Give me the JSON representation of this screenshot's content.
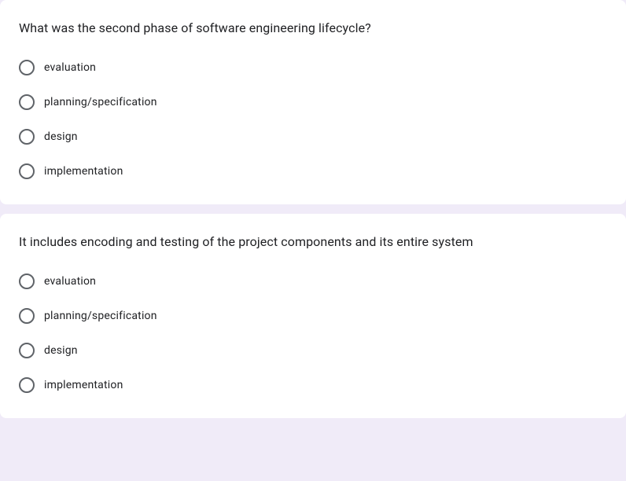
{
  "questions": [
    {
      "prompt": "What was the second phase of software engineering lifecycle?",
      "options": [
        "evaluation",
        "planning/specification",
        "design",
        "implementation"
      ]
    },
    {
      "prompt": "It includes encoding and testing of the project components and its entire system",
      "options": [
        "evaluation",
        "planning/specification",
        "design",
        "implementation"
      ]
    }
  ]
}
